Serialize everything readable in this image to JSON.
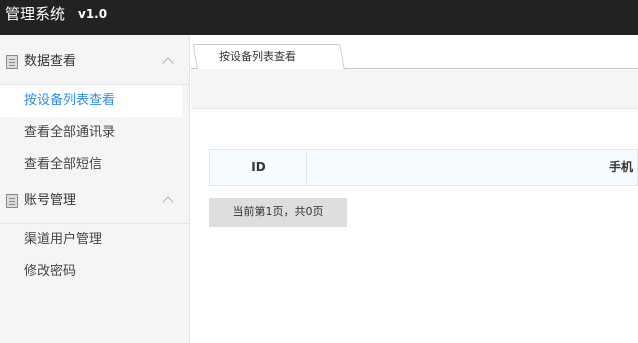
{
  "header": {
    "title": "管理系统",
    "version": "v1.0"
  },
  "sidebar": {
    "groups": [
      {
        "label": "数据查看",
        "icon": "document-icon",
        "items": [
          {
            "label": "按设备列表查看",
            "active": true
          },
          {
            "label": "查看全部通讯录",
            "active": false
          },
          {
            "label": "查看全部短信",
            "active": false
          }
        ]
      },
      {
        "label": "账号管理",
        "icon": "document-icon",
        "items": [
          {
            "label": "渠道用户管理",
            "active": false
          },
          {
            "label": "修改密码",
            "active": false
          }
        ]
      }
    ]
  },
  "tabs": [
    {
      "label": "按设备列表查看",
      "active": true
    }
  ],
  "grid": {
    "columns": [
      "ID",
      "手机"
    ]
  },
  "pager": {
    "label": "当前第1页，共0页"
  },
  "colors": {
    "header_bg": "#222222",
    "accent": "#2e8ded",
    "sidebar_bg": "#f5f5f5"
  }
}
